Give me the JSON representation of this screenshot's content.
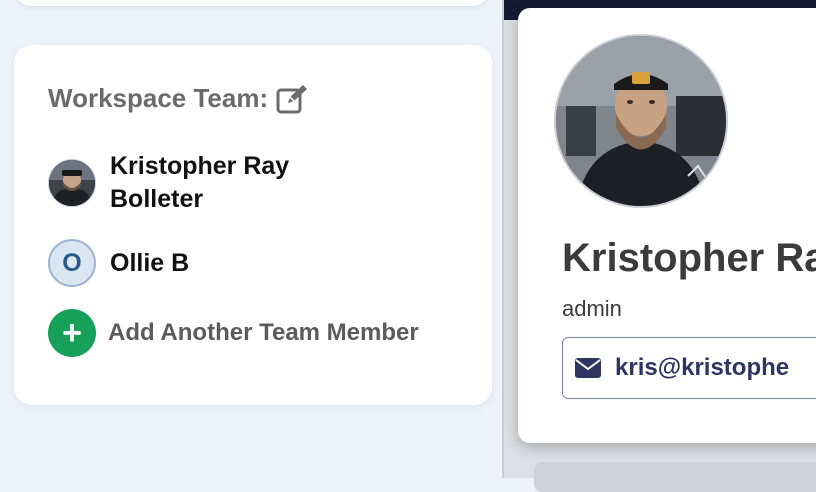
{
  "team_card": {
    "title": "Workspace Team:",
    "edit_icon": "edit-icon",
    "members": [
      {
        "name": "Kristopher Ray Bolleter",
        "avatar": "photo"
      },
      {
        "name": "Ollie B",
        "initial": "O"
      }
    ],
    "add_label": "Add Another Team Member",
    "add_icon": "plus-icon"
  },
  "profile": {
    "name": "Kristopher Ra",
    "role": "admin",
    "email": "kris@kristophe",
    "email_icon": "envelope-icon"
  },
  "colors": {
    "accent_green": "#16a05a",
    "dark_strip": "#141a33",
    "email_text": "#2e3560"
  }
}
